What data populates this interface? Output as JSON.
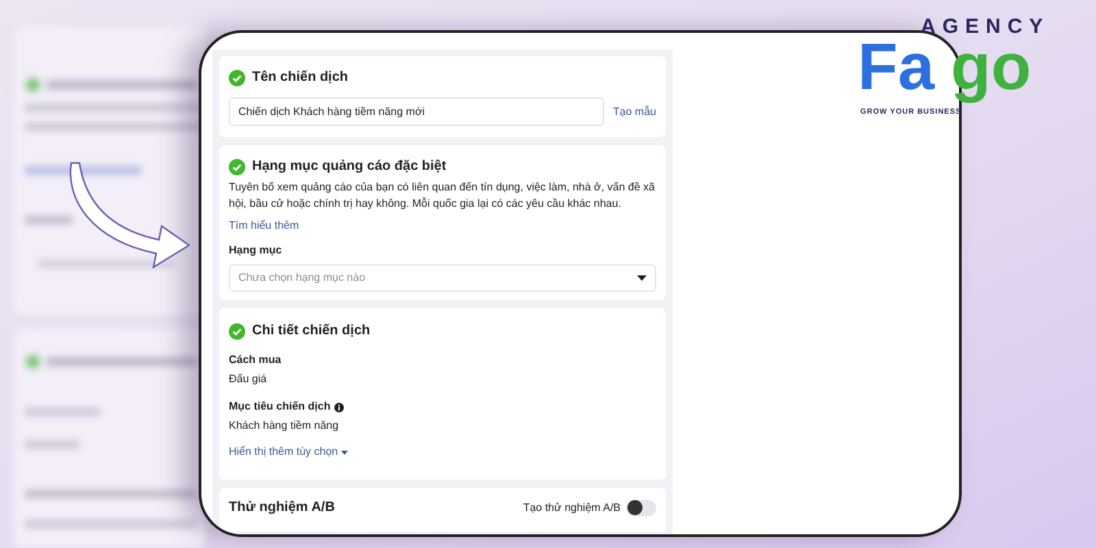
{
  "logo": {
    "top": "AGENCY",
    "left": "Fa",
    "right": "go",
    "tagline": "GROW YOUR BUSINESS"
  },
  "cards": [
    {
      "kind": "name",
      "title": "Tên chiến dịch",
      "done": true,
      "value": "Chiến dịch Khách hàng tiềm năng mới",
      "link": "Tạo mẫu"
    },
    {
      "kind": "category",
      "title": "Hạng mục quảng cáo đặc biệt",
      "done": true,
      "description": "Tuyên bố xem quảng cáo của bạn có liên quan đến tín dụng, việc làm, nhà ở, vấn đề xã hội, bầu cử hoặc chính trị hay không. Mỗi quốc gia lại có các yêu cầu khác nhau.",
      "link": "Tìm hiểu thêm",
      "label": "Hạng mục",
      "placeholder": "Chưa chọn hạng mục nào"
    },
    {
      "kind": "details",
      "title": "Chi tiết chiến dịch",
      "done": true,
      "fields": [
        {
          "label": "Cách mua",
          "value": "Đấu giá",
          "info": false
        },
        {
          "label": "Mục tiêu chiến dịch",
          "value": "Khách hàng tiềm năng",
          "info": true
        }
      ],
      "link": "Hiển thị thêm tùy chọn"
    },
    {
      "kind": "ab",
      "title": "Thử nghiệm A/B",
      "toggle_label": "Tạo thử nghiệm A/B",
      "on": false
    }
  ]
}
